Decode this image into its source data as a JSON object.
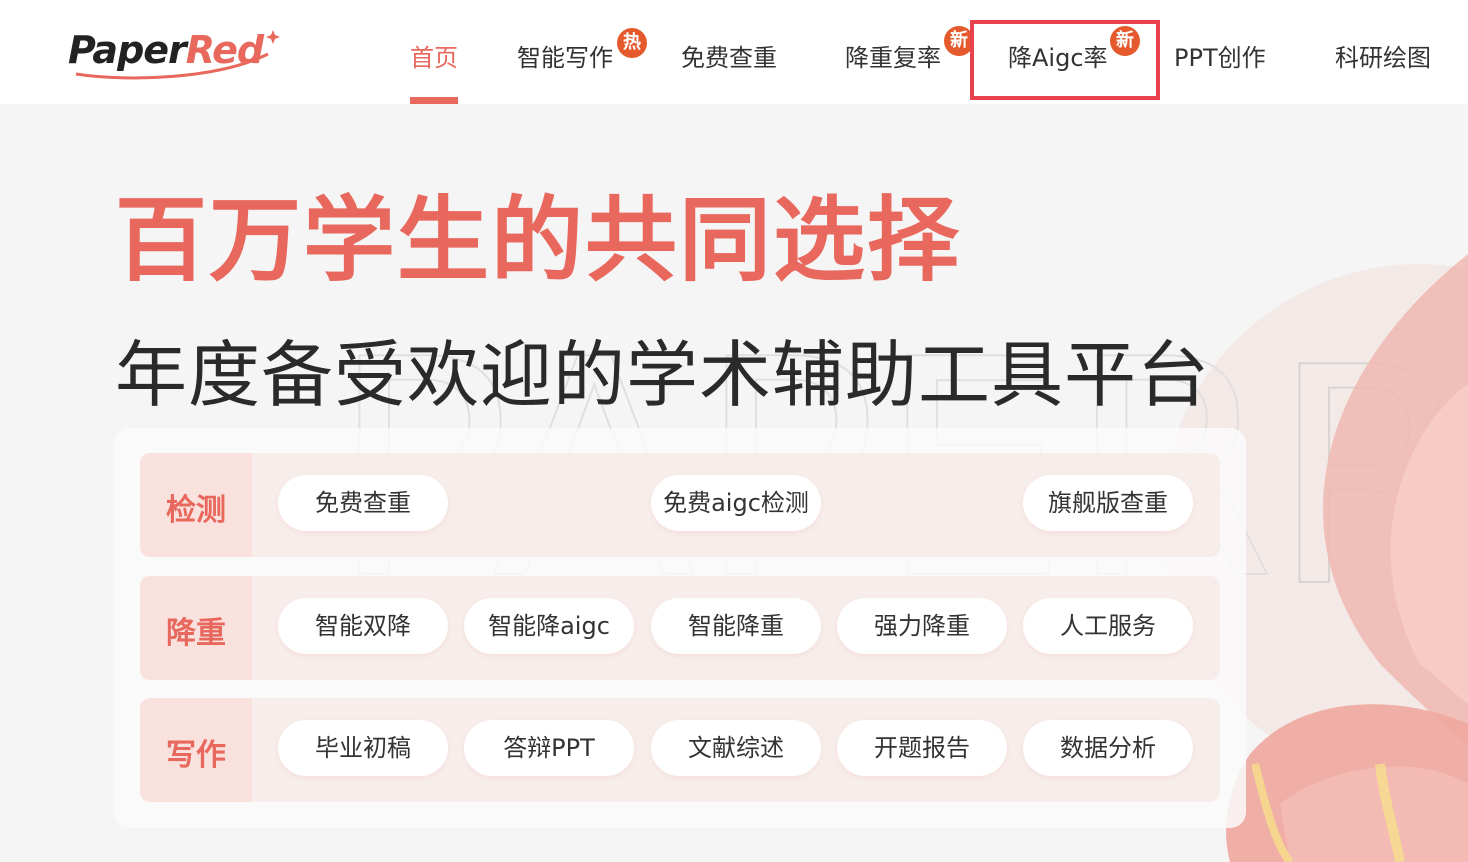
{
  "brand": {
    "logo_part1": "Paper",
    "logo_part2": "Red"
  },
  "nav": {
    "items": [
      {
        "label": "首页",
        "active": true
      },
      {
        "label": "智能写作",
        "badge": "热"
      },
      {
        "label": "免费查重"
      },
      {
        "label": "降重复率",
        "badge": "新"
      },
      {
        "label": "降Aigc率",
        "badge": "新",
        "highlighted": true
      },
      {
        "label": "PPT创作"
      },
      {
        "label": "科研绘图"
      }
    ]
  },
  "hero": {
    "title": "百万学生的共同选择",
    "subtitle": "年度备受欢迎的学术辅助工具平台",
    "watermark": "PAPER"
  },
  "panel": {
    "rows": [
      {
        "label": "检测",
        "items": [
          "免费查重",
          "免费aigc检测",
          "旗舰版查重"
        ]
      },
      {
        "label": "降重",
        "items": [
          "智能双降",
          "智能降aigc",
          "智能降重",
          "强力降重",
          "人工服务"
        ]
      },
      {
        "label": "写作",
        "items": [
          "毕业初稿",
          "答辩PPT",
          "文献综述",
          "开题报告",
          "数据分析"
        ]
      }
    ]
  },
  "colors": {
    "accent": "#e8685d",
    "badge": "#e55a2d",
    "highlight": "#e8424f"
  },
  "icons": [
    "sparkle-icon",
    "hot-badge-icon",
    "new-badge-icon"
  ]
}
